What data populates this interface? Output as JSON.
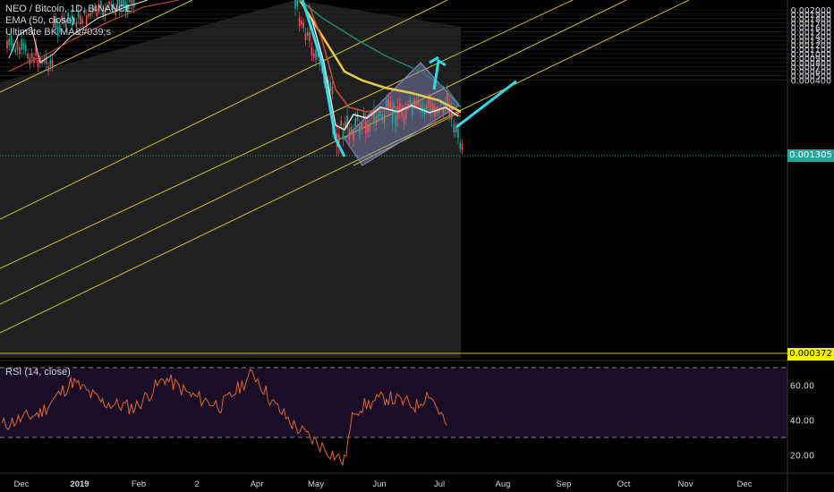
{
  "legend": {
    "line1": "NEO / Bitcoin, 1D, BINANCE",
    "line2": "EMA (50, close)",
    "line3": "Ultimate BK MA&#039;s"
  },
  "rsi_label": "RSI (14, close)",
  "badges": {
    "current_price": "0.001305",
    "target_price": "0.000372"
  },
  "colors": {
    "background": "#000000",
    "candle_up": "#26a69a",
    "candle_down": "#ef5350",
    "ema50": "#e6cc4a",
    "ma_red": "#d04a3a",
    "ma_white": "#e8e8e8",
    "ma_teal": "#1f8a74",
    "channel": "#c9c02a",
    "arrow": "#35d8e8",
    "rsi_line": "#e0632a",
    "rsi_band": "#1a0d28",
    "flag_box": "#8a8fc8"
  },
  "chart_data": [
    {
      "type": "candlestick",
      "title": "NEO / Bitcoin, 1D, BINANCE",
      "y_axis": {
        "range": [
          0.000372,
          0.00206
        ],
        "ticks": [
          "0.002000",
          "0.001900",
          "0.001800",
          "0.001700",
          "0.001600",
          "0.001500",
          "0.001400",
          "0.001300",
          "0.001200",
          "0.001100",
          "0.001000",
          "0.000900",
          "0.000800",
          "0.000700",
          "0.000600",
          "0.000500",
          "0.000400"
        ]
      },
      "x_axis": {
        "ticks": [
          "Dec",
          "2019",
          "Feb",
          "2",
          "Apr",
          "May",
          "Jun",
          "Jul",
          "Aug",
          "Sep",
          "Oct",
          "Nov",
          "Dec"
        ]
      },
      "last_price": 0.001305,
      "target_price": 0.000372,
      "series": [
        {
          "name": "EMA (50, close)",
          "values": [
            {
              "x": "2019-03-20",
              "y": 0.00212
            },
            {
              "x": "2019-04-10",
              "y": 0.00195
            },
            {
              "x": "2019-04-25",
              "y": 0.00178
            },
            {
              "x": "2019-05-10",
              "y": 0.00168
            },
            {
              "x": "2019-05-25",
              "y": 0.00162
            },
            {
              "x": "2019-06-10",
              "y": 0.00157
            },
            {
              "x": "2019-06-25",
              "y": 0.00155
            },
            {
              "x": "2019-07-10",
              "y": 0.0015
            }
          ]
        }
      ],
      "projection": [
        {
          "x": "2019-07-10",
          "y": 0.0013
        },
        {
          "x": "2019-08-10",
          "y": 0.000372
        }
      ]
    },
    {
      "type": "line",
      "title": "RSI (14, close)",
      "y_axis": {
        "ticks": [
          "60.00",
          "40.00",
          "20.00"
        ],
        "bands": [
          30,
          70
        ]
      },
      "series": [
        {
          "name": "",
          "values": [
            {
              "x": "2018-12-01",
              "y": 37
            },
            {
              "x": "2018-12-20",
              "y": 44
            },
            {
              "x": "2019-01-05",
              "y": 62
            },
            {
              "x": "2019-01-20",
              "y": 50
            },
            {
              "x": "2019-02-05",
              "y": 47
            },
            {
              "x": "2019-02-20",
              "y": 64
            },
            {
              "x": "2019-03-05",
              "y": 54
            },
            {
              "x": "2019-03-20",
              "y": 48
            },
            {
              "x": "2019-04-05",
              "y": 67
            },
            {
              "x": "2019-04-15",
              "y": 49
            },
            {
              "x": "2019-04-25",
              "y": 37
            },
            {
              "x": "2019-05-05",
              "y": 28
            },
            {
              "x": "2019-05-20",
              "y": 16
            },
            {
              "x": "2019-05-25",
              "y": 46
            },
            {
              "x": "2019-06-10",
              "y": 53
            },
            {
              "x": "2019-06-25",
              "y": 48
            },
            {
              "x": "2019-07-01",
              "y": 56
            },
            {
              "x": "2019-07-10",
              "y": 37
            }
          ]
        }
      ]
    }
  ]
}
